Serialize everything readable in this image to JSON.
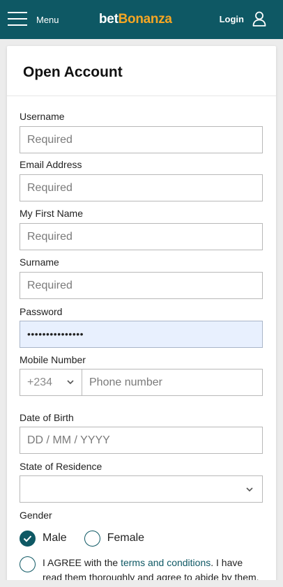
{
  "header": {
    "menu_label": "Menu",
    "logo_part1": "bet",
    "logo_part2": "Bonanza",
    "login_label": "Login"
  },
  "form": {
    "title": "Open Account",
    "username": {
      "label": "Username",
      "placeholder": "Required"
    },
    "email": {
      "label": "Email Address",
      "placeholder": "Required"
    },
    "first_name": {
      "label": "My First Name",
      "placeholder": "Required"
    },
    "surname": {
      "label": "Surname",
      "placeholder": "Required"
    },
    "password": {
      "label": "Password",
      "value": "•••••••••••••••"
    },
    "mobile": {
      "label": "Mobile Number",
      "country_code": "+234",
      "placeholder": "Phone number"
    },
    "dob": {
      "label": "Date of Birth",
      "placeholder": "DD / MM / YYYY"
    },
    "state": {
      "label": "State of Residence",
      "value": ""
    },
    "gender": {
      "label": "Gender",
      "options": [
        "Male",
        "Female"
      ],
      "selected": "Male"
    },
    "agree": {
      "prefix": "I AGREE with the ",
      "link": "terms and conditions",
      "suffix": ". I have read them thoroughly and agree to abide by them."
    }
  },
  "colors": {
    "header_bg": "#0e5864",
    "logo_accent": "#f6a623",
    "autofill_bg": "#e8f0fe"
  }
}
